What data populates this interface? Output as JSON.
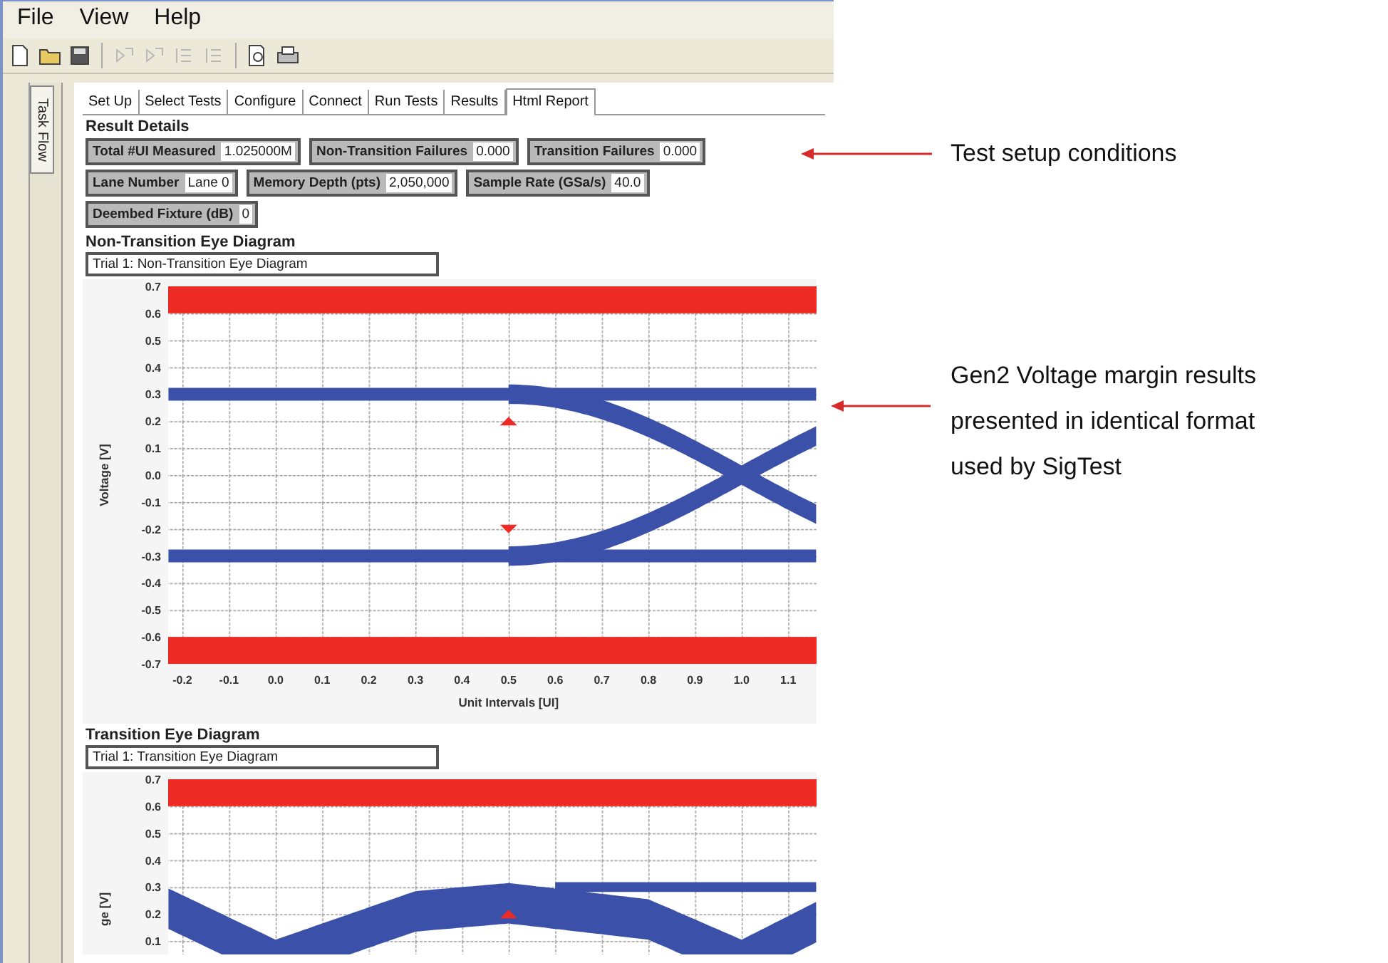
{
  "menu": [
    "File",
    "View",
    "Help"
  ],
  "toolbar": [
    {
      "kind": "new",
      "disabled": false
    },
    {
      "kind": "open",
      "disabled": false
    },
    {
      "kind": "save",
      "disabled": false
    },
    {
      "kind": "step",
      "disabled": true
    },
    {
      "kind": "step",
      "disabled": true
    },
    {
      "kind": "list",
      "disabled": true
    },
    {
      "kind": "list",
      "disabled": true
    },
    {
      "kind": "preview",
      "disabled": false
    },
    {
      "kind": "print",
      "disabled": false
    }
  ],
  "side_tab": {
    "label": "Task Flow"
  },
  "tabs": [
    {
      "label": "Set Up",
      "selected": false
    },
    {
      "label": "Select Tests",
      "selected": false
    },
    {
      "label": "Configure",
      "selected": false
    },
    {
      "label": "Connect",
      "selected": false
    },
    {
      "label": "Run Tests",
      "selected": false
    },
    {
      "label": "Results",
      "selected": false
    },
    {
      "label": "Html Report",
      "selected": true
    }
  ],
  "result_title": "Result Details",
  "field_rows": [
    {
      "fields": [
        {
          "label": "Total #UI Measured",
          "value": "1.025000M"
        },
        {
          "label": "Non-Transition Failures",
          "value": "0.000"
        },
        {
          "label": "Transition Failures",
          "value": "0.000"
        }
      ]
    },
    {
      "fields": [
        {
          "label": "Lane Number",
          "value": "Lane 0"
        },
        {
          "label": "Memory Depth (pts)",
          "value": "2,050,000"
        },
        {
          "label": "Sample Rate (GSa/s)",
          "value": "40.0"
        }
      ]
    },
    {
      "fields": [
        {
          "label": "Deembed Fixture (dB)",
          "value": "0"
        }
      ]
    }
  ],
  "diagrams": [
    {
      "kind": "non_transition",
      "title": "Non-Transition Eye Diagram",
      "trial": "Trial 1: Non-Transition Eye Diagram",
      "ylabel": "Voltage [V]",
      "yticks": [
        "0.7",
        "0.6",
        "0.5",
        "0.4",
        "0.3",
        "0.2",
        "0.1",
        "0.0",
        "-0.1",
        "-0.2",
        "-0.3",
        "-0.4",
        "-0.5",
        "-0.6",
        "-0.7"
      ],
      "xticks": [
        "-0.2",
        "-0.1",
        "0.0",
        "0.1",
        "0.2",
        "0.3",
        "0.4",
        "0.5",
        "0.6",
        "0.7",
        "0.8",
        "0.9",
        "1.0",
        "1.1"
      ],
      "xlabel": "Unit Intervals [UI]"
    },
    {
      "kind": "transition",
      "title": "Transition Eye Diagram",
      "trial": "Trial 1: Transition Eye Diagram",
      "ylabel": "ge [V]",
      "yticks": [
        "0.7",
        "0.6",
        "0.5",
        "0.4",
        "0.3",
        "0.2",
        "0.1"
      ]
    }
  ],
  "annotations": [
    {
      "lines": [
        "Test setup conditions"
      ]
    },
    {
      "lines": [
        "Gen2 Voltage margin results",
        "presented in identical format",
        "used by SigTest"
      ]
    }
  ]
}
